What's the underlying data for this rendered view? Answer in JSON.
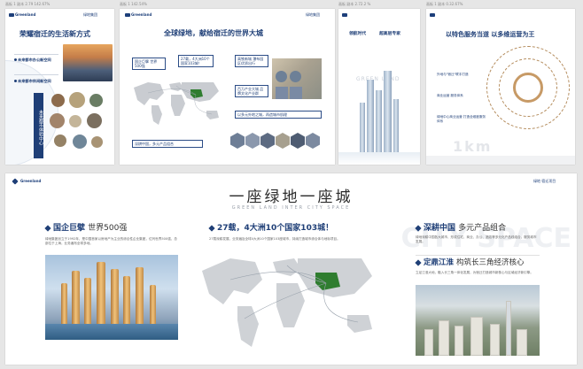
{
  "captions": [
    "画板 1 副本 2.79  142.67%",
    "画板 1 142.54%",
    "画板 副本 2.72.2 %",
    "画板 1 副本 0.32.67%"
  ],
  "logo": {
    "left": "Greenland",
    "right": "绿地集团",
    "right_alt": "绿地 宿迁"
  },
  "page1": {
    "title": "荣耀宿迁的生活新方式",
    "item1": "未来都市办公新空间",
    "item2": "未来都市休闲新空间",
    "vertical": "未来都市体验中心"
  },
  "page2": {
    "title": "全球绿地，献给宿迁的世界大城",
    "box1": "国企巨擘 世界500强",
    "box2": "27载，4大洲10个国家103城！",
    "box3": "深耕中国，多元产品组合",
    "box4": "高铁新城 瀑布园区优质出行",
    "box5": "百万产业大城 品牌文化产业群",
    "box6": "以多元外地之城，再造城市肌理"
  },
  "page3": {
    "title1": "领航时代",
    "title2": "超高层专家",
    "watermark": "GREEN LAND"
  },
  "page4": {
    "title": "以特色服务当道 以多维运营为王",
    "bullets": [
      "外地与\"宿迁\"联手打造",
      "商业运营 服务体系",
      "绿地中心商业运营 打造全维度服务体系"
    ],
    "big": "1km"
  },
  "page5": {
    "logo_left": "Greenland",
    "logo_right": "绿地 宿迁项目",
    "headline": "一座绿地一座城",
    "subhead": "GREEN LAND INTER CITY SPACE",
    "section1": {
      "bold": "国企巨擘",
      "light": "世界500强"
    },
    "section1_text": "绿地集团创立于1992年，是中国首家以房地产为主业的综合性企业集团，位列世界500强，总部位于上海，业务遍布全球多地。",
    "section2": {
      "bold": "27载，4大洲10个国家103城！"
    },
    "section2_text": "27载深耕发展，业务遍及全球4大洲10个国家103座城市，持续打造城市综合体与地标项目。",
    "section3": {
      "bold": "深耕中国",
      "light": "多元产品组合"
    },
    "section3_text": "绿地深耕中国各大城市，形成住宅、商业、办公、酒店等多元化产品线组合，服务城市发展。",
    "section4": {
      "bold": "定鼎江淮",
      "light": "构筑长三角经济核心"
    },
    "section4_text": "立足江淮大地，融入长三角一体化发展，为宿迁打造城市新核心与区域经济新引擎。",
    "watermark": "CITY SPACE"
  },
  "colors": {
    "navy": "#1f3f77",
    "gold": "#c79a66",
    "china_green": "#2f7d2f"
  }
}
